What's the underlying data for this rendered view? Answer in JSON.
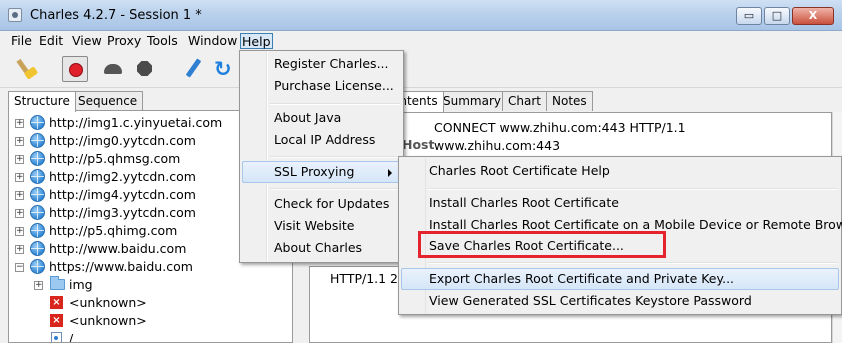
{
  "window": {
    "title": "Charles 4.2.7 - Session 1 *",
    "min_label": "▭",
    "max_label": "□",
    "close_label": "X"
  },
  "menubar": [
    "File",
    "Edit",
    "View",
    "Proxy",
    "Tools",
    "Window",
    "Help"
  ],
  "toolbar": {
    "icons": [
      "broom-icon",
      "record-icon",
      "throttle-turtle-icon",
      "breakpoints-hexagon-icon",
      "compose-pen-icon",
      "refresh-icon"
    ],
    "refresh_glyph": "↻"
  },
  "left_tabs": [
    "Structure",
    "Sequence"
  ],
  "tree": [
    {
      "label": "http://img1.c.yinyuetai.com",
      "expander": "+",
      "icon": "globe-icon"
    },
    {
      "label": "http://img0.yytcdn.com",
      "expander": "+",
      "icon": "globe-icon"
    },
    {
      "label": "http://p5.qhmsg.com",
      "expander": "+",
      "icon": "globe-icon"
    },
    {
      "label": "http://img2.yytcdn.com",
      "expander": "+",
      "icon": "globe-icon"
    },
    {
      "label": "http://img4.yytcdn.com",
      "expander": "+",
      "icon": "globe-icon"
    },
    {
      "label": "http://img3.yytcdn.com",
      "expander": "+",
      "icon": "globe-icon"
    },
    {
      "label": "http://p5.qhimg.com",
      "expander": "+",
      "icon": "globe-icon"
    },
    {
      "label": "http://www.baidu.com",
      "expander": "+",
      "icon": "globe-icon"
    },
    {
      "label": "https://www.baidu.com",
      "expander": "−",
      "icon": "globe-icon"
    },
    {
      "label": "img",
      "expander": "+",
      "icon": "folder-icon"
    },
    {
      "label": "<unknown>",
      "expander": "",
      "icon": "error-x-icon"
    },
    {
      "label": "<unknown>",
      "expander": "",
      "icon": "error-x-icon"
    },
    {
      "label": "/",
      "expander": "",
      "icon": "document-icon"
    }
  ],
  "right_tabs": [
    "ontents",
    "Summary",
    "Chart",
    "Notes"
  ],
  "detail": {
    "request_line": "CONNECT www.zhihu.com:443 HTTP/1.1",
    "host_key": "Host",
    "host_value": "www.zhihu.com:443"
  },
  "response": {
    "line": "HTTP/1.1 2"
  },
  "help_menu": {
    "items": [
      {
        "label": "Register Charles..."
      },
      {
        "label": "Purchase License..."
      },
      {
        "label": "About Java"
      },
      {
        "label": "Local IP Address"
      },
      {
        "label": "SSL Proxying"
      },
      {
        "label": "Check for Updates"
      },
      {
        "label": "Visit Website"
      },
      {
        "label": "About Charles"
      }
    ]
  },
  "ssl_submenu": {
    "items": [
      {
        "label": "Charles Root Certificate Help"
      },
      {
        "label": "Install Charles Root Certificate"
      },
      {
        "label": "Install Charles Root Certificate on a Mobile Device or Remote Browser"
      },
      {
        "label": "Save Charles Root Certificate..."
      },
      {
        "label": "Export Charles Root Certificate and Private Key..."
      },
      {
        "label": "View Generated SSL Certificates Keystore Password"
      }
    ]
  },
  "colors": {
    "highlight_box": "#e5232f",
    "menu_highlight": "#d5e6f8",
    "titlebar": "#b9d1ec"
  }
}
